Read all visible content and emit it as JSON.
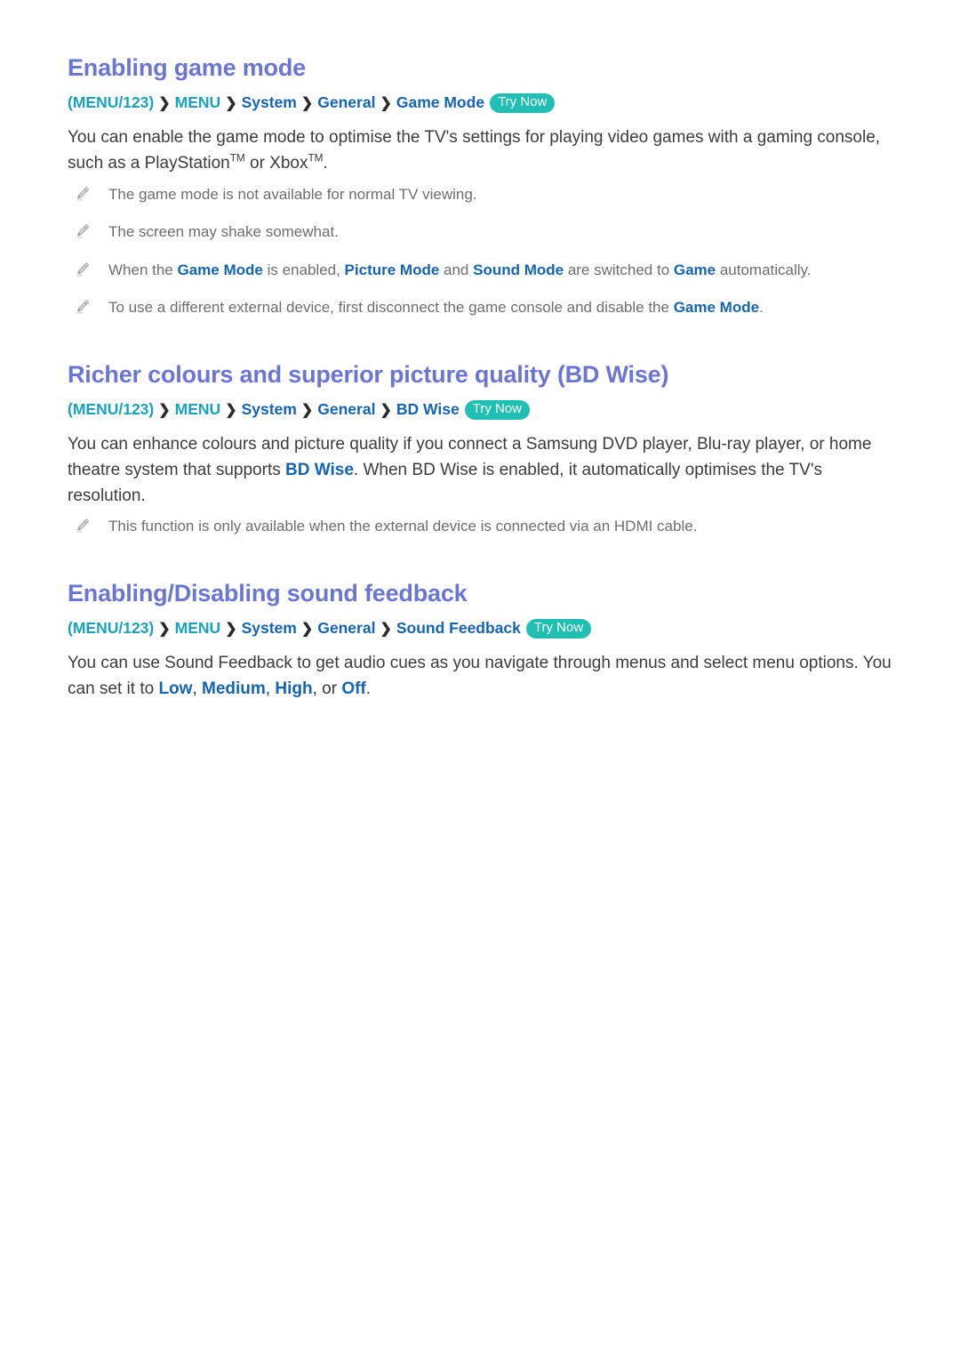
{
  "colors": {
    "heading": "#6a76d2",
    "crumb_teal": "#19a3ba",
    "crumb_blue": "#1565b0",
    "badge_bg": "#1fbfb4",
    "badge_text": "#ffffff",
    "body_text": "#3c3c3c",
    "note_text": "#6e6e6e",
    "pencil_icon": "#b4b4b4"
  },
  "sections": [
    {
      "title": "Enabling game mode",
      "breadcrumb": {
        "open_paren": "(",
        "root": "MENU/123",
        "close_paren": ")",
        "separator": "❯",
        "items": [
          "MENU",
          "System",
          "General",
          "Game Mode"
        ],
        "badge": "Try Now"
      },
      "paragraphs": [
        {
          "parts": [
            {
              "text": "You can enable the game mode to optimise the TV's settings for playing video games with a gaming console, such as a PlayStation",
              "style": "plain"
            },
            {
              "text": "TM",
              "style": "superscript"
            },
            {
              "text": " or Xbox",
              "style": "plain"
            },
            {
              "text": "TM",
              "style": "superscript"
            },
            {
              "text": ".",
              "style": "plain"
            }
          ]
        }
      ],
      "notes": [
        {
          "parts": [
            {
              "text": "The game mode is not available for normal TV viewing.",
              "style": "plain"
            }
          ]
        },
        {
          "parts": [
            {
              "text": "The screen may shake somewhat.",
              "style": "plain"
            }
          ]
        },
        {
          "parts": [
            {
              "text": "When the ",
              "style": "plain"
            },
            {
              "text": "Game Mode",
              "style": "highlight"
            },
            {
              "text": " is enabled, ",
              "style": "plain"
            },
            {
              "text": "Picture Mode",
              "style": "highlight"
            },
            {
              "text": " and ",
              "style": "plain"
            },
            {
              "text": "Sound Mode",
              "style": "highlight"
            },
            {
              "text": " are switched to ",
              "style": "plain"
            },
            {
              "text": "Game",
              "style": "highlight"
            },
            {
              "text": " automatically.",
              "style": "plain"
            }
          ]
        },
        {
          "parts": [
            {
              "text": "To use a different external device, first disconnect the game console and disable the ",
              "style": "plain"
            },
            {
              "text": "Game Mode",
              "style": "highlight"
            },
            {
              "text": ".",
              "style": "plain"
            }
          ]
        }
      ]
    },
    {
      "title": "Richer colours and superior picture quality (BD Wise)",
      "breadcrumb": {
        "open_paren": "(",
        "root": "MENU/123",
        "close_paren": ")",
        "separator": "❯",
        "items": [
          "MENU",
          "System",
          "General",
          "BD Wise"
        ],
        "badge": "Try Now"
      },
      "paragraphs": [
        {
          "parts": [
            {
              "text": "You can enhance colours and picture quality if you connect a Samsung DVD player, Blu-ray player, or home theatre system that supports ",
              "style": "plain"
            },
            {
              "text": "BD Wise",
              "style": "highlight"
            },
            {
              "text": ". When BD Wise is enabled, it automatically optimises the TV's resolution.",
              "style": "plain"
            }
          ]
        }
      ],
      "notes": [
        {
          "parts": [
            {
              "text": "This function is only available when the external device is connected via an HDMI cable.",
              "style": "plain"
            }
          ]
        }
      ]
    },
    {
      "title": "Enabling/Disabling sound feedback",
      "breadcrumb": {
        "open_paren": "(",
        "root": "MENU/123",
        "close_paren": ")",
        "separator": "❯",
        "items": [
          "MENU",
          "System",
          "General",
          "Sound Feedback"
        ],
        "badge": "Try Now"
      },
      "paragraphs": [
        {
          "parts": [
            {
              "text": "You can use Sound Feedback to get audio cues as you navigate through menus and select menu options. You can set it to ",
              "style": "plain"
            },
            {
              "text": "Low",
              "style": "highlight"
            },
            {
              "text": ", ",
              "style": "plain"
            },
            {
              "text": "Medium",
              "style": "highlight"
            },
            {
              "text": ", ",
              "style": "plain"
            },
            {
              "text": "High",
              "style": "highlight"
            },
            {
              "text": ", or ",
              "style": "plain"
            },
            {
              "text": "Off",
              "style": "highlight"
            },
            {
              "text": ".",
              "style": "plain"
            }
          ]
        }
      ],
      "notes": []
    }
  ]
}
